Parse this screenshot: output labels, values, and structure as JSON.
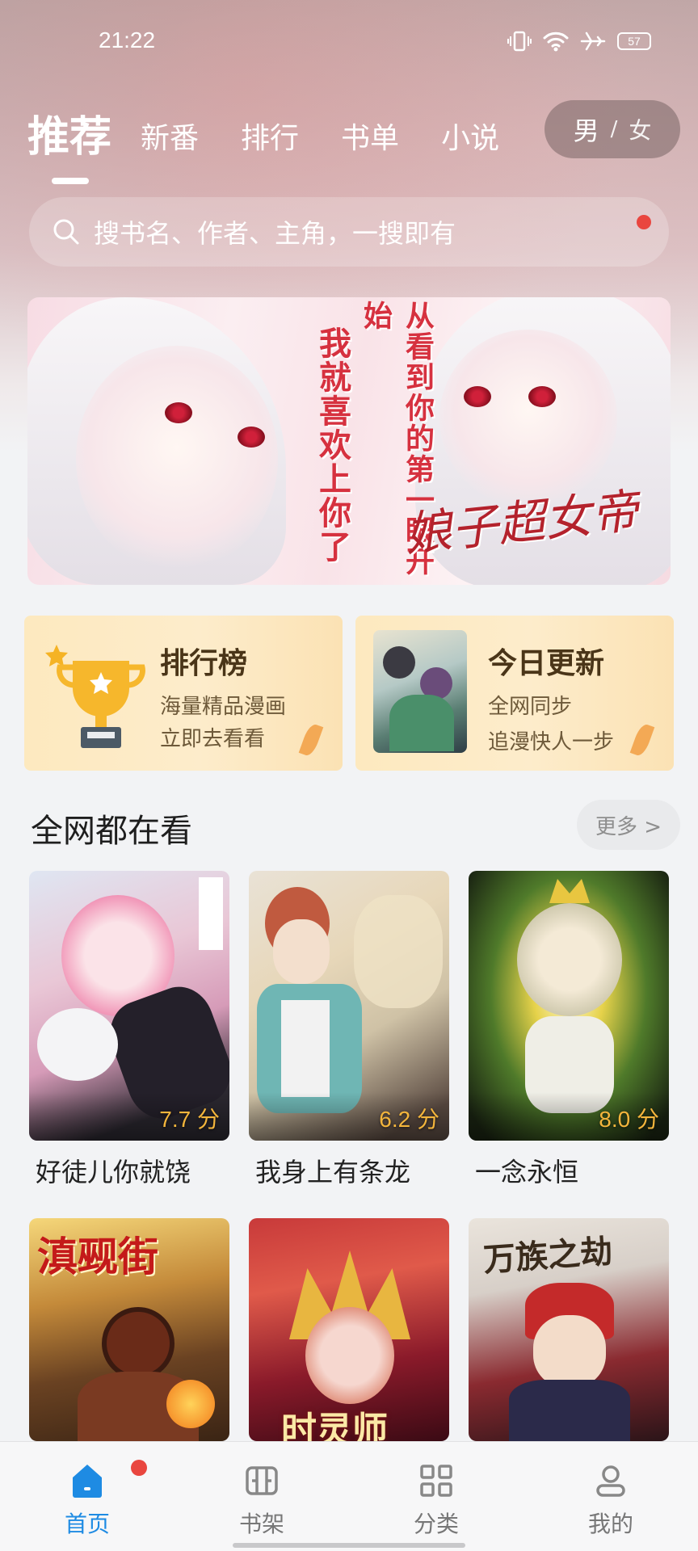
{
  "status_bar": {
    "time": "21:22",
    "battery": "57"
  },
  "top_tabs": [
    {
      "label": "推荐",
      "active": true
    },
    {
      "label": "新番"
    },
    {
      "label": "排行"
    },
    {
      "label": "书单"
    },
    {
      "label": "小说"
    }
  ],
  "gender": {
    "male": "男",
    "separator": "/",
    "female": "女"
  },
  "search": {
    "placeholder": "搜书名、作者、主角，一搜即有"
  },
  "banner": {
    "line_a": "我就喜欢上你了",
    "line_b": "从看到你的第一眼开始",
    "logo": "娘子超女帝"
  },
  "rank_card": {
    "title": "排行榜",
    "line1": "海量精品漫画",
    "line2": "立即去看看"
  },
  "update_card": {
    "title": "今日更新",
    "line1": "全网同步",
    "line2": "追漫快人一步"
  },
  "section": {
    "title": "全网都在看",
    "more": "更多 >"
  },
  "books": [
    {
      "title": "好徒儿你就饶",
      "score": "7.7 分"
    },
    {
      "title": "我身上有条龙",
      "score": "6.2 分"
    },
    {
      "title": "一念永恒",
      "score": "8.0 分"
    },
    {
      "cover_text": "滇觋街"
    },
    {
      "cover_text": "时灵师"
    },
    {
      "cover_text": "万族之劫"
    }
  ],
  "bottom_nav": [
    {
      "label": "首页",
      "icon": "home-icon",
      "active": true
    },
    {
      "label": "书架",
      "icon": "bookshelf-icon"
    },
    {
      "label": "分类",
      "icon": "category-icon"
    },
    {
      "label": "我的",
      "icon": "profile-icon"
    }
  ],
  "colors": {
    "accent": "#1e8be3",
    "badge_red": "#e9463f",
    "score_gold": "#f3b53c"
  }
}
